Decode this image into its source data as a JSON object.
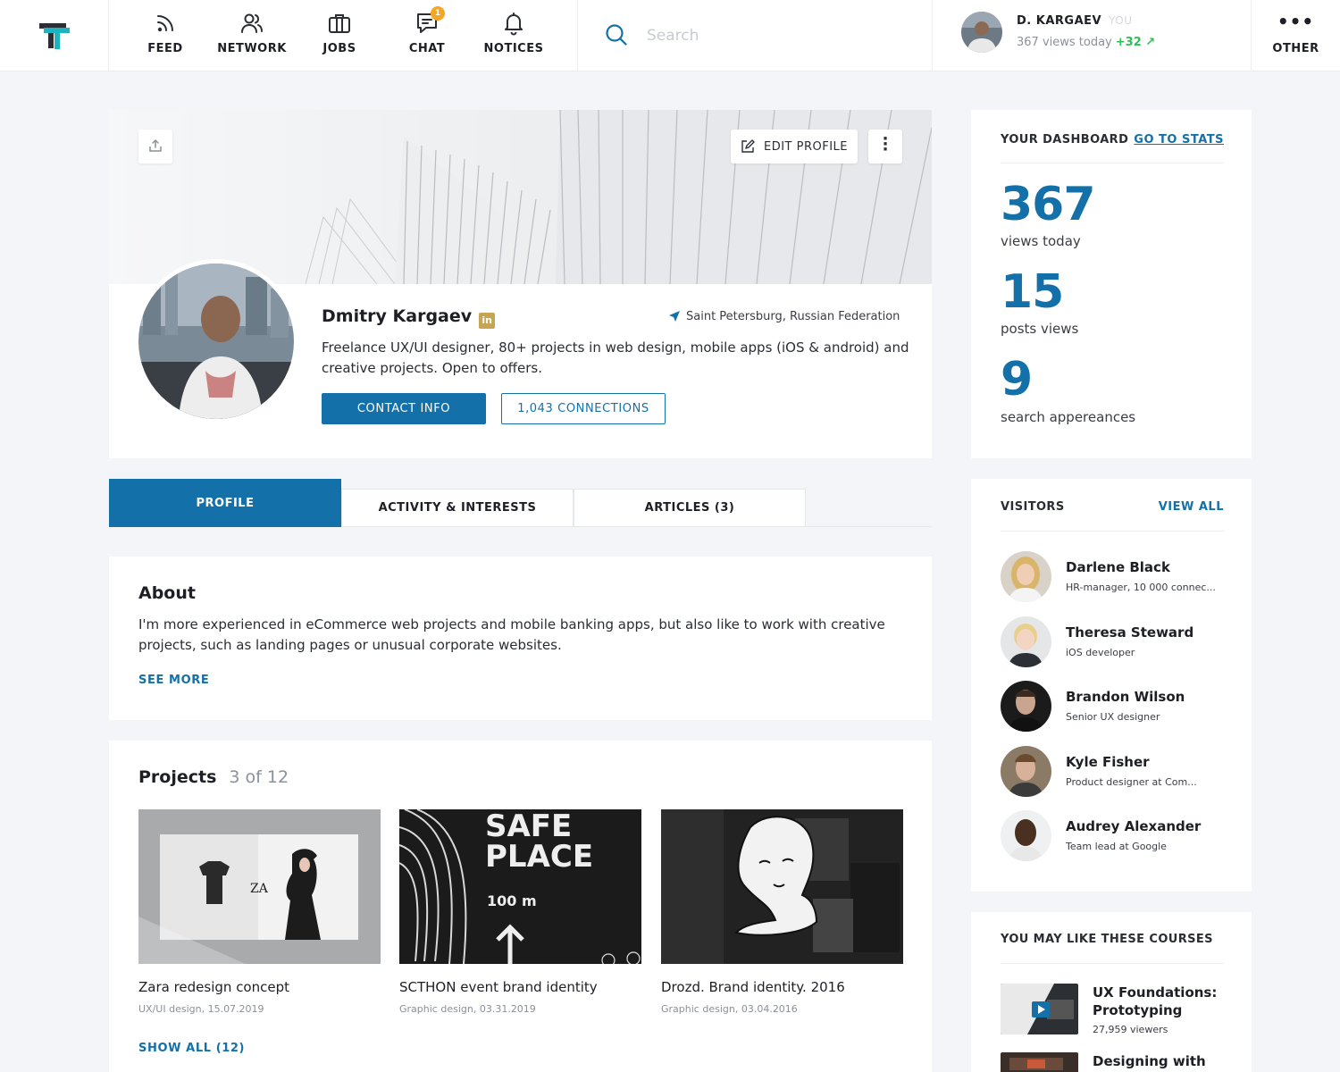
{
  "nav": {
    "items": [
      {
        "label": "FEED",
        "icon": "rss-icon"
      },
      {
        "label": "NETWORK",
        "icon": "people-icon"
      },
      {
        "label": "JOBS",
        "icon": "briefcase-icon"
      },
      {
        "label": "CHAT",
        "icon": "chat-icon",
        "badge": "1"
      },
      {
        "label": "NOTICES",
        "icon": "bell-icon"
      }
    ],
    "search_placeholder": "Search",
    "user": {
      "name": "D. KARGAEV",
      "you": "YOU",
      "views": "367 views today",
      "delta": "+32 ↗"
    },
    "other_label": "OTHER",
    "other_icon": "•••"
  },
  "profile": {
    "edit_label": "EDIT PROFILE",
    "name": "Dmitry Kargaev",
    "linkedin_glyph": "in",
    "location": "Saint Petersburg, Russian Federation",
    "bio": "Freelance UX/UI designer, 80+ projects in web design, mobile apps  (iOS & android) and creative projects. Open to offers.",
    "contact_label": "CONTACT INFO",
    "connections_label": "1,043 CONNECTIONS"
  },
  "tabs": [
    {
      "label": "PROFILE",
      "active": true
    },
    {
      "label": "ACTIVITY & INTERESTS",
      "active": false
    },
    {
      "label": "ARTICLES (3)",
      "active": false
    }
  ],
  "about": {
    "title": "About",
    "text": "I'm more experienced in eCommerce web projects and mobile banking apps, but also like to work with creative projects, such as landing pages or unusual corporate websites.",
    "see_more": "SEE MORE"
  },
  "projects": {
    "title": "Projects",
    "count": "3 of 12",
    "items": [
      {
        "title": "Zara redesign concept",
        "meta": "UX/UI design, 15.07.2019",
        "thumb_text": "ZA"
      },
      {
        "title": "SCTHON event brand identity",
        "meta": "Graphic design, 03.31.2019",
        "thumb_text": "SAFE",
        "thumb_text2": "PLACE",
        "thumb_text3": "100 m"
      },
      {
        "title": "Drozd. Brand identity. 2016",
        "meta": "Graphic design, 03.04.2016"
      }
    ],
    "show_all": "SHOW ALL (12)"
  },
  "dashboard": {
    "title": "YOUR DASHBOARD",
    "link": "GO TO STATS",
    "stats": [
      {
        "value": "367",
        "label": "views today"
      },
      {
        "value": "15",
        "label": "posts views"
      },
      {
        "value": "9",
        "label": "search appereances"
      }
    ]
  },
  "visitors": {
    "title": "VISITORS",
    "link": "VIEW ALL",
    "items": [
      {
        "name": "Darlene Black",
        "role": "HR-manager, 10 000 connec..."
      },
      {
        "name": "Theresa Steward",
        "role": "iOS developer"
      },
      {
        "name": "Brandon Wilson",
        "role": "Senior UX designer"
      },
      {
        "name": "Kyle Fisher",
        "role": "Product designer at Com..."
      },
      {
        "name": "Audrey Alexander",
        "role": "Team lead at Google"
      }
    ]
  },
  "courses": {
    "title": "YOU MAY LIKE THESE COURSES",
    "items": [
      {
        "title": "UX Foundations: Prototyping",
        "meta": "27,959 viewers"
      },
      {
        "title": "Designing with",
        "meta": ""
      }
    ]
  },
  "colors": {
    "accent": "#1470a8",
    "badge": "#f5a623",
    "positive": "#2ebd59",
    "linkedin": "#c8a455"
  }
}
